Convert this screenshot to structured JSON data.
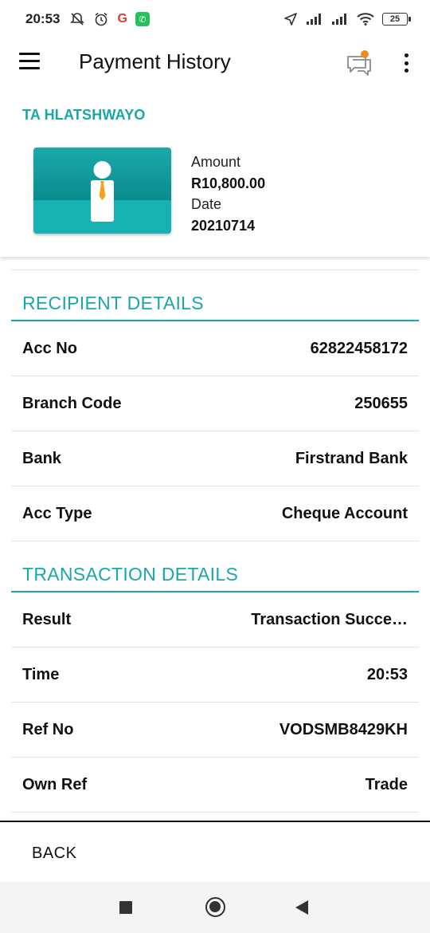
{
  "status_bar": {
    "time": "20:53",
    "battery": "25"
  },
  "app_bar": {
    "title": "Payment History"
  },
  "summary": {
    "recipient_name": "TA HLATSHWAYO",
    "amount_label": "Amount",
    "amount_value": "R10,800.00",
    "date_label": "Date",
    "date_value": "20210714"
  },
  "recipient_details": {
    "heading": "RECIPIENT DETAILS",
    "rows": [
      {
        "label": "Acc No",
        "value": "62822458172"
      },
      {
        "label": "Branch Code",
        "value": "250655"
      },
      {
        "label": "Bank",
        "value": "Firstrand Bank"
      },
      {
        "label": "Acc Type",
        "value": "Cheque Account"
      }
    ]
  },
  "transaction_details": {
    "heading": "TRANSACTION DETAILS",
    "rows": [
      {
        "label": "Result",
        "value": "Transaction Succe…"
      },
      {
        "label": "Time",
        "value": "20:53"
      },
      {
        "label": "Ref No",
        "value": "VODSMB8429KH"
      },
      {
        "label": "Own Ref",
        "value": "Trade"
      }
    ]
  },
  "footer": {
    "back_label": "BACK"
  },
  "colors": {
    "accent": "#1aa7a8",
    "notification_dot": "#f08a24"
  }
}
